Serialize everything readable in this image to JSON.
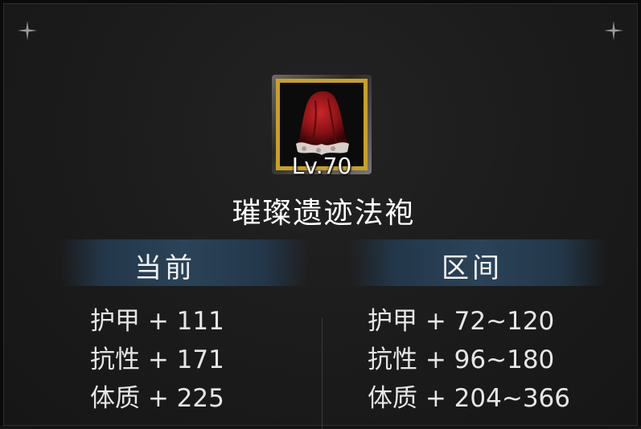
{
  "item": {
    "level_label": "Lv.70",
    "name": "璀璨遗迹法袍",
    "icon": "red-hood-robe-icon",
    "frame_color": "#c9a021"
  },
  "columns": {
    "current": {
      "title": "当前",
      "stats": [
        "护甲 + 111",
        "抗性 + 171",
        "体质 + 225"
      ]
    },
    "range": {
      "title": "区间",
      "stats": [
        "护甲 + 72~120",
        "抗性 + 96~180",
        "体质 + 204~366"
      ]
    }
  },
  "colors": {
    "header_band": "#2b4358",
    "background": "#1b1b1b"
  }
}
